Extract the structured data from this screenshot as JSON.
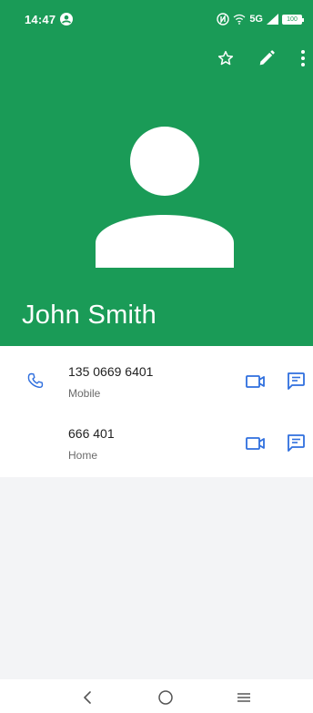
{
  "status_bar": {
    "time": "14:47",
    "network": "5G",
    "battery": "100"
  },
  "toolbar": {
    "favorite_icon": "star-outline-icon",
    "edit_icon": "pencil-icon",
    "more_icon": "more-vert-icon"
  },
  "contact": {
    "name": "John Smith",
    "avatar_icon": "person-silhouette-icon",
    "header_color": "#1a9b57"
  },
  "phones": [
    {
      "number": "135 0669 6401",
      "type": "Mobile",
      "show_call_icon": true
    },
    {
      "number": "666 401",
      "type": "Home",
      "show_call_icon": false
    }
  ],
  "accent_color": "#2f6fde",
  "nav": {
    "back_icon": "chevron-left-icon",
    "home_icon": "circle-home-icon",
    "recents_icon": "menu-lines-icon"
  }
}
